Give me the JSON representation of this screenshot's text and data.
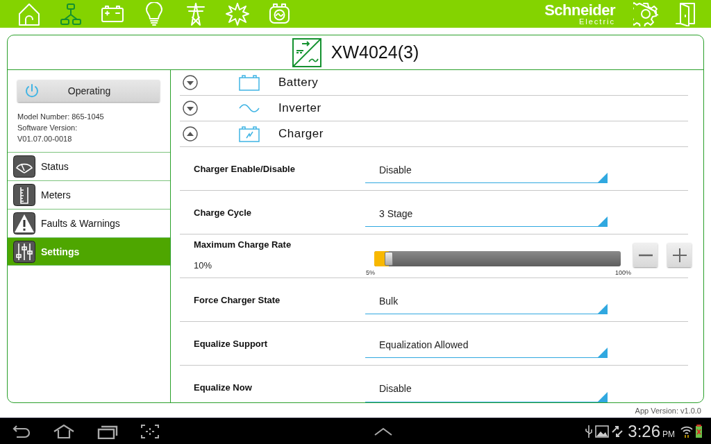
{
  "top_bar": {
    "nav_icons": [
      {
        "kind": "home",
        "selected": false
      },
      {
        "kind": "network",
        "selected": true
      },
      {
        "kind": "battery",
        "selected": false
      },
      {
        "kind": "bulb",
        "selected": false
      },
      {
        "kind": "tower",
        "selected": false
      },
      {
        "kind": "sun",
        "selected": false
      },
      {
        "kind": "generator",
        "selected": false
      }
    ],
    "logo": {
      "name": "Schneider",
      "sub": "Electric"
    }
  },
  "device": {
    "title": "XW4024(3)"
  },
  "sidebar": {
    "operating_button": "Operating",
    "info": [
      "Model Number: 865-1045",
      "Software Version:",
      "V01.07.00-0018"
    ],
    "items": [
      {
        "label": "Status",
        "kind": "gauge",
        "selected": false
      },
      {
        "label": "Meters",
        "kind": "meter",
        "selected": false
      },
      {
        "label": "Faults & Warnings",
        "kind": "warning",
        "selected": false
      },
      {
        "label": "Settings",
        "kind": "sliders",
        "selected": true
      }
    ]
  },
  "sections": [
    {
      "label": "Battery",
      "kind": "battery",
      "expanded": false
    },
    {
      "label": "Inverter",
      "kind": "wave",
      "expanded": false
    },
    {
      "label": "Charger",
      "kind": "charger",
      "expanded": true
    }
  ],
  "settings": [
    {
      "kind": "dropdown",
      "label": "Charger Enable/Disable",
      "value": "Disable"
    },
    {
      "kind": "dropdown",
      "label": "Charge Cycle",
      "value": "3 Stage"
    },
    {
      "kind": "slider",
      "label": "Maximum Charge Rate",
      "value": "10%",
      "level": 0.06,
      "min": "5%",
      "max": "100%"
    },
    {
      "kind": "dropdown",
      "label": "Force Charger State",
      "value": "Bulk"
    },
    {
      "kind": "dropdown",
      "label": "Equalize Support",
      "value": "Equalization Allowed"
    },
    {
      "kind": "dropdown",
      "label": "Equalize Now",
      "value": "Disable"
    }
  ],
  "app_version": "App Version: v1.0.0",
  "system_bar": {
    "time": "3:26",
    "ampm": "PM"
  }
}
